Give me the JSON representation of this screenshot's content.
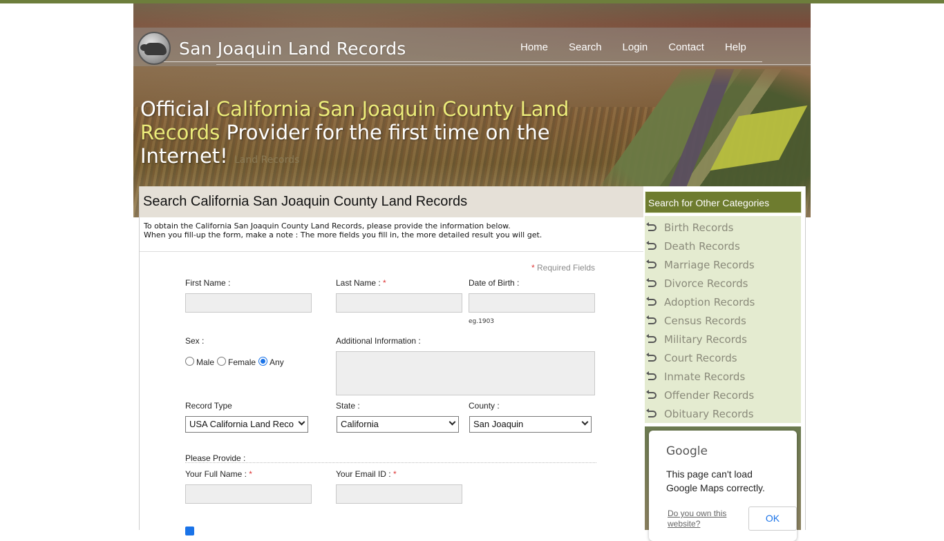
{
  "header": {
    "site_title": "San Joaquin Land Records",
    "nav": [
      "Home",
      "Search",
      "Login",
      "Contact",
      "Help"
    ]
  },
  "hero": {
    "tag_part1": "Official ",
    "tag_highlight": "California San Joaquin County Land Records",
    "tag_part2": " Provider for the first time on the Internet!",
    "tag_ghost": "Land Records"
  },
  "main": {
    "title": "Search California San Joaquin County Land Records",
    "intro_line1": "To obtain the California San Joaquin County Land Records, please provide the information below.",
    "intro_line2": "When you fill-up the form, make a note : The more fields you fill in, the more detailed result you will get."
  },
  "form": {
    "required_note": "Required Fields",
    "first_name_label": "First Name :",
    "last_name_label": "Last Name :",
    "dob_label": "Date of Birth :",
    "dob_hint": "eg.1903",
    "sex_label": "Sex :",
    "sex_options": [
      "Male",
      "Female",
      "Any"
    ],
    "sex_selected": "Any",
    "additional_label": "Additional Information :",
    "record_type_label": "Record Type",
    "record_type_value": "USA California Land Records",
    "state_label": "State :",
    "state_value": "California",
    "county_label": "County :",
    "county_value": "San Joaquin",
    "please_provide": "Please Provide :",
    "full_name_label": "Your Full Name :",
    "email_label": "Your Email ID :"
  },
  "sidebar": {
    "heading": "Search for Other Categories",
    "items": [
      "Birth Records",
      "Death Records",
      "Marriage Records",
      "Divorce Records",
      "Adoption Records",
      "Census Records",
      "Military Records",
      "Court Records",
      "Inmate Records",
      "Offender Records",
      "Obituary Records"
    ]
  },
  "map_error": {
    "brand": "Google",
    "message": "This page can't load Google Maps correctly.",
    "link": "Do you own this website?",
    "ok": "OK"
  },
  "colors": {
    "accent_green": "#6e7c2f",
    "highlight_yellow": "#ecec7a",
    "sidebar_bg": "#e4ebd0"
  }
}
